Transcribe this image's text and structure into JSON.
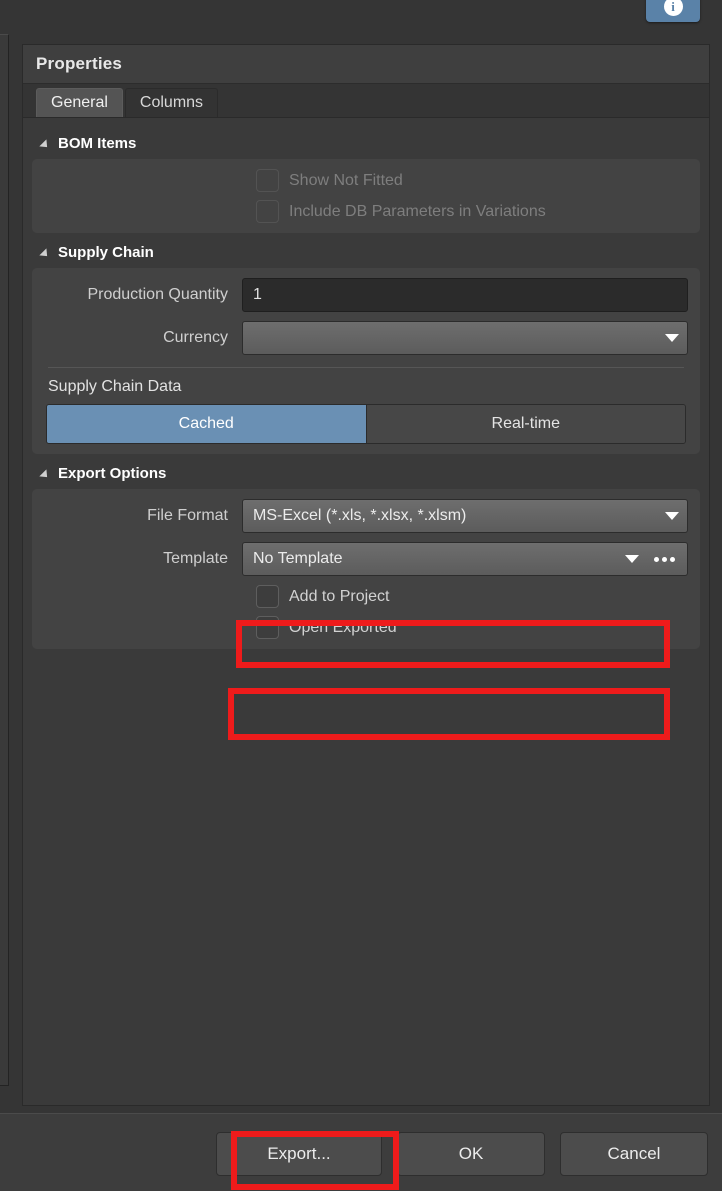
{
  "window": {
    "info_button_glyph": "i",
    "info_button_name": "info-icon"
  },
  "dialog": {
    "title": "Properties",
    "tabs": [
      {
        "label": "General",
        "active": true
      },
      {
        "label": "Columns",
        "active": false
      }
    ]
  },
  "sections": {
    "bom_items": {
      "title": "BOM Items",
      "checkboxes": [
        {
          "label": "Show Not Fitted",
          "checked": false,
          "enabled": false
        },
        {
          "label": "Include DB Parameters in Variations",
          "checked": false,
          "enabled": false
        }
      ]
    },
    "supply_chain": {
      "title": "Supply Chain",
      "production_quantity_label": "Production Quantity",
      "production_quantity_value": "1",
      "currency_label": "Currency",
      "currency_value": "",
      "supply_chain_data_label": "Supply Chain Data",
      "toggle": {
        "cached_label": "Cached",
        "realtime_label": "Real-time",
        "selected": "Cached"
      }
    },
    "export_options": {
      "title": "Export Options",
      "file_format_label": "File Format",
      "file_format_value": "MS-Excel (*.xls, *.xlsx, *.xlsm)",
      "template_label": "Template",
      "template_value": "No Template",
      "checkboxes": [
        {
          "label": "Add to Project",
          "checked": false,
          "enabled": true
        },
        {
          "label": "Open Exported",
          "checked": false,
          "enabled": true
        }
      ]
    }
  },
  "footer": {
    "export_label": "Export...",
    "ok_label": "OK",
    "cancel_label": "Cancel"
  },
  "colors": {
    "accent_blue": "#6a90b4",
    "annotation_red": "#ee1b1b",
    "panel_bg": "#3a3a3a",
    "group_bg": "#434343"
  }
}
